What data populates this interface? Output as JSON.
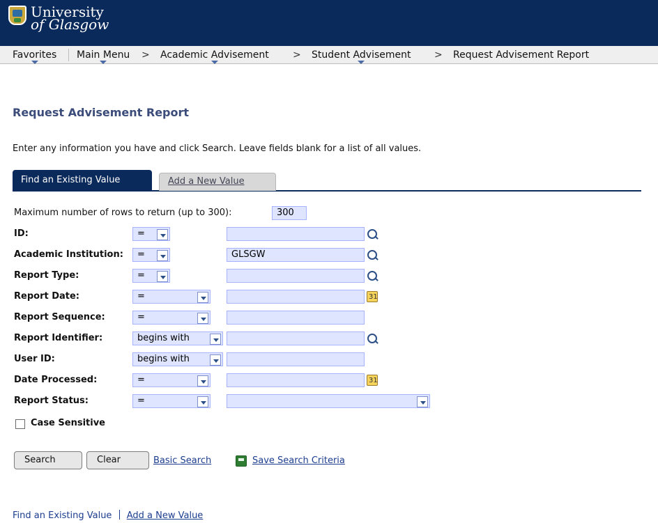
{
  "app": {
    "brand": {
      "line1": "University",
      "line2": "of Glasgow"
    }
  },
  "nav": {
    "favorites": "Favorites",
    "main_menu": "Main Menu",
    "academic_advisement": "Academic Advisement",
    "student_advisement": "Student Advisement",
    "request_advisement_report": "Request Advisement Report",
    "separator": ">"
  },
  "page": {
    "title": "Request Advisement Report",
    "instruction": "Enter any information you have and click Search. Leave fields blank for a list of all values."
  },
  "tabs": {
    "find_existing": "Find an Existing Value",
    "add_new": "Add a New Value"
  },
  "form": {
    "max_rows_label": "Maximum number of rows to return (up to 300):",
    "max_rows_value": "300",
    "rows": [
      {
        "label": "ID:",
        "operator": "=",
        "value": ""
      },
      {
        "label": "Academic Institution:",
        "operator": "=",
        "value": "GLSGW"
      },
      {
        "label": "Report Type:",
        "operator": "=",
        "value": ""
      },
      {
        "label": "Report Date:",
        "operator": "=",
        "value": ""
      },
      {
        "label": "Report Sequence:",
        "operator": "=",
        "value": ""
      },
      {
        "label": "Report Identifier:",
        "operator": "begins with",
        "value": ""
      },
      {
        "label": "User ID:",
        "operator": "begins with",
        "value": ""
      },
      {
        "label": "Date Processed:",
        "operator": "=",
        "value": ""
      },
      {
        "label": "Report Status:",
        "operator": "=",
        "value": ""
      }
    ],
    "case_sensitive": "Case Sensitive"
  },
  "actions": {
    "search": "Search",
    "clear": "Clear",
    "basic_search": "Basic Search",
    "save_search_criteria": "Save Search Criteria"
  },
  "footer": {
    "find_existing": "Find an Existing Value",
    "add_new": "Add a New Value"
  }
}
